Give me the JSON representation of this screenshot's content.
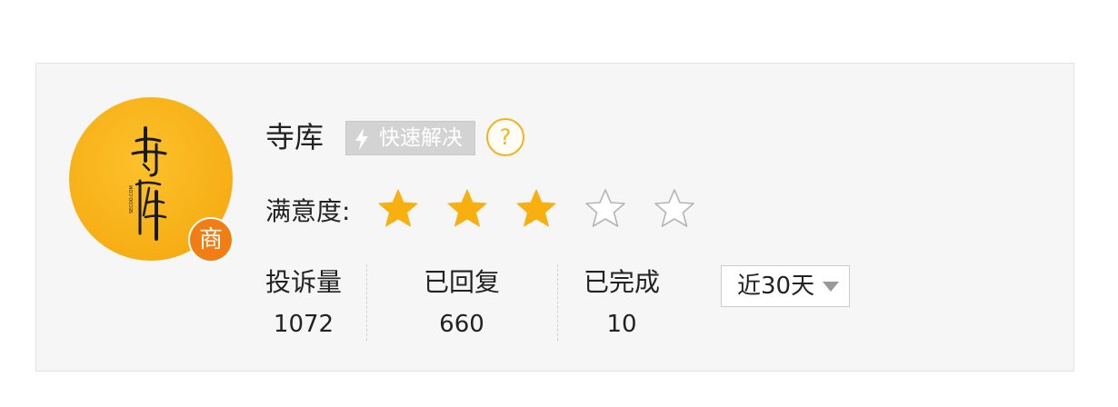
{
  "shop": {
    "name": "寺库",
    "merchant_badge": "商",
    "fast_badge": "快速解决",
    "help_symbol": "?",
    "logo_text": "寺库"
  },
  "rating": {
    "label": "满意度:",
    "value": 3,
    "max": 5,
    "filled_color": "#f7b010",
    "empty_color": "#b5b5b5"
  },
  "stats": [
    {
      "label": "投诉量",
      "value": "1072"
    },
    {
      "label": "已回复",
      "value": "660"
    },
    {
      "label": "已完成",
      "value": "10"
    }
  ],
  "period": {
    "selected": "近30天"
  },
  "icons": {
    "fast_badge_icon": "lightning-icon",
    "help_icon": "question-circle-icon",
    "select_icon": "triangle-down-icon"
  }
}
